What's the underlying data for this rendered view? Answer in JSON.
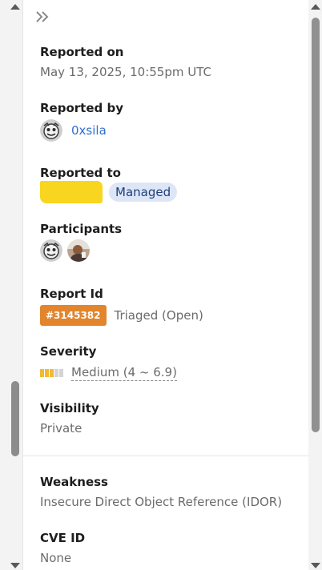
{
  "fields": {
    "reported_on": {
      "label": "Reported on",
      "value": "May 13, 2025, 10:55pm UTC"
    },
    "reported_by": {
      "label": "Reported by",
      "username": "0xsila"
    },
    "reported_to": {
      "label": "Reported to",
      "badge": "Managed"
    },
    "participants": {
      "label": "Participants"
    },
    "report_id": {
      "label": "Report Id",
      "id": "#3145382",
      "status": "Triaged (Open)"
    },
    "severity": {
      "label": "Severity",
      "value": "Medium (4 ~ 6.9)",
      "level_filled": 3,
      "level_total": 5
    },
    "visibility": {
      "label": "Visibility",
      "value": "Private"
    },
    "weakness": {
      "label": "Weakness",
      "value": "Insecure Direct Object Reference (IDOR)"
    },
    "cve": {
      "label": "CVE ID",
      "value": "None"
    }
  },
  "colors": {
    "report_badge": "#e2852c",
    "severity_on": "#f2b933",
    "severity_off": "#d4d4d4",
    "link": "#2f6fd0",
    "redaction": "#f8d51f"
  },
  "icons": {
    "collapse": "double-chevron-right-icon",
    "scroll_up": "arrow-up-icon",
    "scroll_down": "arrow-down-icon"
  }
}
